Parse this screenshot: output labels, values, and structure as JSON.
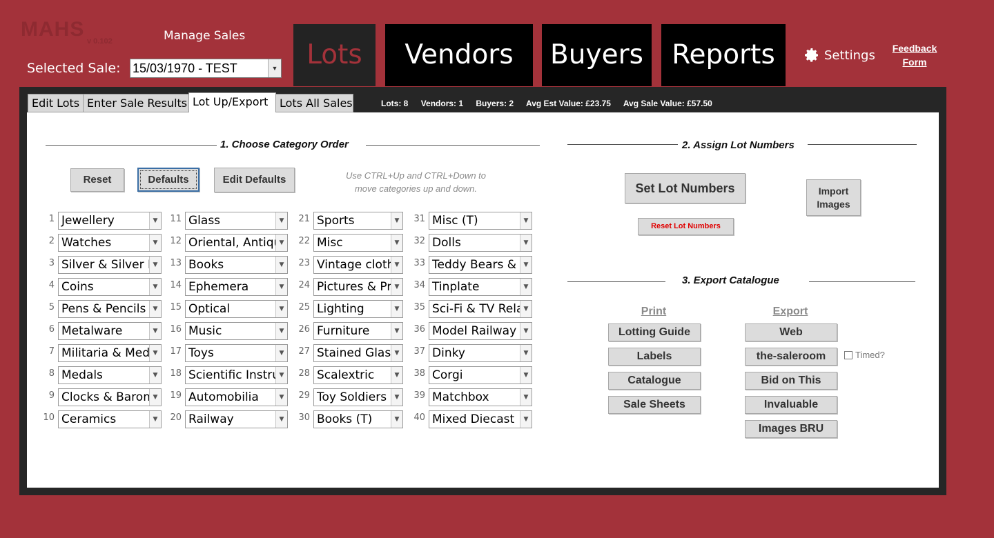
{
  "app": {
    "logo": "MAHS",
    "version": "v 0.102",
    "title": "Manage Sales"
  },
  "sale": {
    "label": "Selected Sale:",
    "value": "15/03/1970 - TEST"
  },
  "main_tabs": [
    "Lots",
    "Vendors",
    "Buyers",
    "Reports"
  ],
  "settings_label": "Settings",
  "feedback": {
    "line1": "Feedback",
    "line2": "Form"
  },
  "sub_tabs": [
    "Edit Lots",
    "Enter Sale Results",
    "Lot Up/Export",
    "Lots All Sales"
  ],
  "stats": {
    "lots": "Lots: 8",
    "vendors": "Vendors: 1",
    "buyers": "Buyers: 2",
    "avg_est": "Avg Est Value: £23.75",
    "avg_sale": "Avg Sale Value: £57.50"
  },
  "section1": {
    "title": "1. Choose Category Order",
    "reset": "Reset",
    "defaults": "Defaults",
    "edit_defaults": "Edit Defaults",
    "hint_line1": "Use CTRL+Up and CTRL+Down to",
    "hint_line2": "move categories up and down."
  },
  "categories": [
    "Jewellery",
    "Watches",
    "Silver & Silver Pla",
    "Coins",
    "Pens & Pencils",
    "Metalware",
    "Militaria & Meda",
    "Medals",
    "Clocks & Barome",
    "Ceramics",
    "Glass",
    "Oriental, Antiqui",
    "Books",
    "Ephemera",
    "Optical",
    "Music",
    "Toys",
    "Scientific Instrun",
    "Automobilia",
    "Railway",
    "Sports",
    "Misc",
    "Vintage clothir",
    "Pictures & Prir",
    "Lighting",
    "Furniture",
    "Stained Glass .",
    "Scalextric",
    "Toy Soldiers &",
    "Books (T)",
    "Misc (T)",
    "Dolls",
    "Teddy Bears & Sc",
    "Tinplate",
    "Sci-Fi & TV Relate",
    "Model Railway",
    "Dinky",
    "Corgi",
    "Matchbox",
    "Mixed Diecast"
  ],
  "section2": {
    "title": "2. Assign Lot Numbers",
    "set_lot_numbers": "Set Lot Numbers",
    "import_images_1": "Import",
    "import_images_2": "Images",
    "reset_lot_numbers": "Reset Lot Numbers"
  },
  "section3": {
    "title": "3. Export Catalogue",
    "print_head": "Print",
    "export_head": "Export",
    "print_buttons": [
      "Lotting Guide",
      "Labels",
      "Catalogue",
      "Sale Sheets"
    ],
    "export_buttons": [
      "Web",
      "the-saleroom",
      "Bid on This",
      "Invaluable",
      "Images BRU"
    ],
    "timed_label": "Timed?",
    "timed_checked": false
  },
  "colors": {
    "background": "#a3323a",
    "panel": "#262626",
    "reset_red": "#e00000"
  },
  "icons": {
    "settings": "gear-icon",
    "dropdown": "chevron-down-icon"
  }
}
